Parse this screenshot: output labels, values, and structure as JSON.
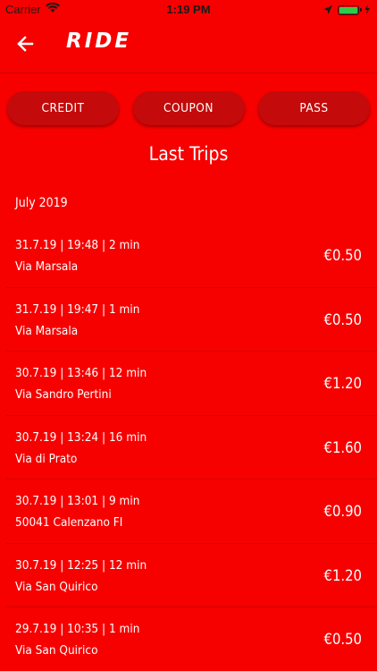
{
  "status_bar": {
    "carrier": "Carrier",
    "time": "1:19 PM",
    "battery_color": "#35c94a"
  },
  "nav": {
    "logo": "RIDE",
    "back_icon": "arrow-left-icon"
  },
  "segments": [
    {
      "label": "CREDIT"
    },
    {
      "label": "COUPON"
    },
    {
      "label": "PASS"
    }
  ],
  "title": "Last Trips",
  "month": "July 2019",
  "trips": [
    {
      "info": "31.7.19 | 19:48 | 2 min",
      "place": "Via Marsala",
      "price": "€0.50"
    },
    {
      "info": "31.7.19 | 19:47 | 1 min",
      "place": "Via Marsala",
      "price": "€0.50"
    },
    {
      "info": "30.7.19 | 13:46 | 12 min",
      "place": "Via Sandro Pertini",
      "price": "€1.20"
    },
    {
      "info": "30.7.19 | 13:24 | 16 min",
      "place": "Via di Prato",
      "price": "€1.60"
    },
    {
      "info": "30.7.19 | 13:01 | 9 min",
      "place": "50041 Calenzano FI",
      "price": "€0.90"
    },
    {
      "info": "30.7.19 | 12:25 | 12 min",
      "place": "Via San Quirico",
      "price": "€1.20"
    },
    {
      "info": "29.7.19 | 10:35 | 1 min",
      "place": "Via San Quirico",
      "price": "€0.50"
    }
  ],
  "colors": {
    "background": "#f70000",
    "button": "#c40a0a",
    "text": "#ffffff"
  }
}
